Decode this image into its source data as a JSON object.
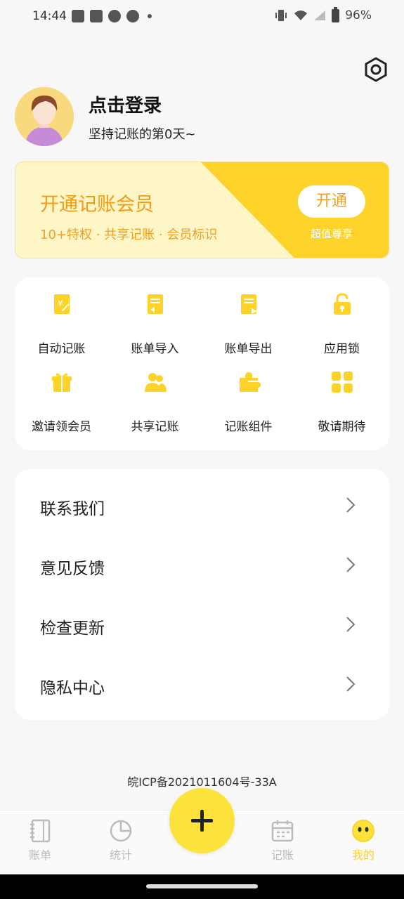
{
  "status_bar": {
    "time": "14:44",
    "battery": "96%"
  },
  "profile": {
    "title": "点击登录",
    "subtitle": "坚持记账的第0天~"
  },
  "vip": {
    "title": "开通记账会员",
    "subtitle": "10+特权 · 共享记账 · 会员标识",
    "button": "开通",
    "button_sub": "超值尊享"
  },
  "features": [
    {
      "label": "自动记账",
      "icon": "auto-bookkeeping-icon"
    },
    {
      "label": "账单导入",
      "icon": "bill-import-icon"
    },
    {
      "label": "账单导出",
      "icon": "bill-export-icon"
    },
    {
      "label": "应用锁",
      "icon": "app-lock-icon"
    },
    {
      "label": "邀请领会员",
      "icon": "gift-icon"
    },
    {
      "label": "共享记账",
      "icon": "shared-users-icon"
    },
    {
      "label": "记账组件",
      "icon": "widget-puzzle-icon"
    },
    {
      "label": "敬请期待",
      "icon": "more-grid-icon"
    }
  ],
  "menu": [
    {
      "label": "联系我们"
    },
    {
      "label": "意见反馈"
    },
    {
      "label": "检查更新"
    },
    {
      "label": "隐私中心"
    }
  ],
  "icp": "皖ICP备2021011604号-33A",
  "nav": [
    {
      "label": "账单",
      "icon": "bill-book-icon"
    },
    {
      "label": "统计",
      "icon": "pie-chart-icon"
    },
    {
      "label": "记账",
      "icon": "calendar-icon"
    },
    {
      "label": "我的",
      "icon": "smiley-icon"
    }
  ],
  "colors": {
    "accent": "#fdd32a",
    "vip_text": "#f29c16",
    "bg": "#f7f7f7"
  }
}
